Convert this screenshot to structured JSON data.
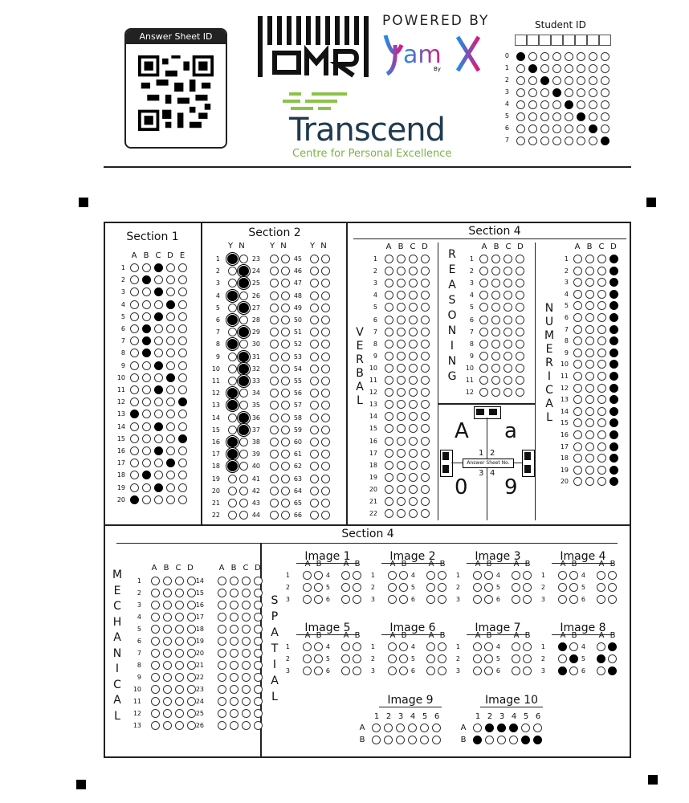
{
  "header": {
    "answer_sheet_id_label": "Answer Sheet ID",
    "omr_logo_text": "OMR",
    "powered_by": "POWERED BY",
    "brand": "Yamx",
    "brand_sub": "By",
    "org_name": "Transcend",
    "org_tagline": "Centre for Personal Excellence",
    "student_id_label": "Student ID",
    "student_id_rows": [
      "0",
      "1",
      "2",
      "3",
      "4",
      "5",
      "6",
      "7"
    ],
    "student_id_filled": [
      1,
      2,
      3,
      4,
      5,
      6,
      7,
      8
    ]
  },
  "section1": {
    "title": "Section 1",
    "options": [
      "A",
      "B",
      "C",
      "D",
      "E"
    ],
    "answers": [
      2,
      1,
      2,
      3,
      2,
      1,
      1,
      1,
      2,
      3,
      2,
      4,
      0,
      2,
      4,
      2,
      3,
      1,
      2,
      0
    ]
  },
  "section2": {
    "title": "Section 2",
    "options": [
      "Y",
      "N"
    ],
    "col1_answers": [
      0,
      1,
      1,
      0,
      1,
      0,
      1,
      0,
      1,
      1,
      1,
      0,
      0,
      1,
      1,
      0,
      0,
      0,
      null,
      null,
      null,
      null
    ],
    "col_ranges": [
      [
        1,
        22
      ],
      [
        23,
        44
      ],
      [
        45,
        66
      ]
    ]
  },
  "section4_top": {
    "title": "Section 4",
    "verbal": {
      "label": "VERBAL",
      "options": [
        "A",
        "B",
        "C",
        "D"
      ],
      "count": 22
    },
    "reasoning": {
      "label": "REASONING",
      "options": [
        "A",
        "B",
        "C",
        "D"
      ],
      "count": 12
    },
    "numerical": {
      "label": "NUMERICAL",
      "options": [
        "A",
        "B",
        "C",
        "D"
      ],
      "count": 20,
      "answer": 3
    },
    "answer_sheet_no": "Answer Sheet No.",
    "corner_chars": [
      "A",
      "a",
      "0",
      "9"
    ],
    "corner_nums": [
      "1",
      "2",
      "3",
      "4"
    ]
  },
  "section4_bottom": {
    "title": "Section 4",
    "mechanical": {
      "label": "MECHANICAL",
      "options": [
        "A",
        "B",
        "C",
        "D"
      ],
      "count": 26
    },
    "spatial": {
      "label": "SPATIAL"
    },
    "images": [
      {
        "title": "Image 1"
      },
      {
        "title": "Image 2"
      },
      {
        "title": "Image 3"
      },
      {
        "title": "Image 4"
      },
      {
        "title": "Image 5"
      },
      {
        "title": "Image 6"
      },
      {
        "title": "Image 7"
      },
      {
        "title": "Image 8"
      },
      {
        "title": "Image 9"
      },
      {
        "title": "Image 10"
      }
    ],
    "image8_filled": [
      [
        0,
        0
      ],
      [
        1,
        1
      ],
      [
        2,
        0
      ],
      [
        0,
        3
      ],
      [
        1,
        2
      ],
      [
        2,
        3
      ]
    ],
    "image10_filled": {
      "A": [
        1,
        2,
        3
      ],
      "B": [
        0,
        4,
        5
      ]
    }
  }
}
